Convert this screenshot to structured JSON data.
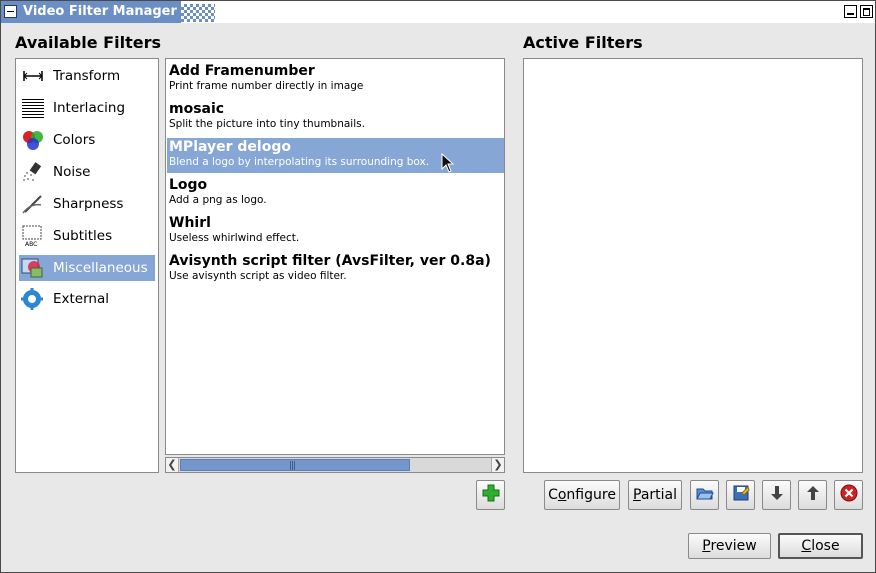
{
  "window": {
    "title": "Video Filter Manager"
  },
  "available": {
    "heading": "Available Filters",
    "categories": [
      {
        "label": "Transform",
        "icon": "transform-icon"
      },
      {
        "label": "Interlacing",
        "icon": "interlacing-icon"
      },
      {
        "label": "Colors",
        "icon": "colors-icon"
      },
      {
        "label": "Noise",
        "icon": "noise-icon"
      },
      {
        "label": "Sharpness",
        "icon": "sharpness-icon"
      },
      {
        "label": "Subtitles",
        "icon": "subtitles-icon"
      },
      {
        "label": "Miscellaneous",
        "icon": "miscellaneous-icon",
        "selected": true
      },
      {
        "label": "External",
        "icon": "external-icon"
      }
    ],
    "filters": [
      {
        "name": "Add Framenumber",
        "desc": "Print frame number directly in image"
      },
      {
        "name": "mosaic",
        "desc": "Split the picture into tiny thumbnails."
      },
      {
        "name": "MPlayer delogo",
        "desc": "Blend a logo by interpolating its surrounding box.",
        "selected": true
      },
      {
        "name": "Logo",
        "desc": "Add a png as logo."
      },
      {
        "name": "Whirl",
        "desc": "Useless whirlwind effect."
      },
      {
        "name": "Avisynth script filter (AvsFilter, ver 0.8a)",
        "desc": "Use avisynth script as video filter."
      }
    ],
    "add_icon": "add-icon"
  },
  "active": {
    "heading": "Active Filters",
    "toolbar": {
      "configure": "Configure",
      "configure_mnemonic": "o",
      "partial": "Partial",
      "partial_mnemonic": "P",
      "icons": [
        "open-icon",
        "save-icon",
        "move-down-icon",
        "move-up-icon",
        "remove-icon"
      ]
    }
  },
  "footer": {
    "preview": "Preview",
    "preview_mnemonic": "P",
    "close": "Close",
    "close_mnemonic": "C"
  },
  "colors": {
    "selection": "#86a6d6",
    "title_accent": "#6b8fc4",
    "add_green": "#2fae2f",
    "remove_red": "#cc2222"
  }
}
